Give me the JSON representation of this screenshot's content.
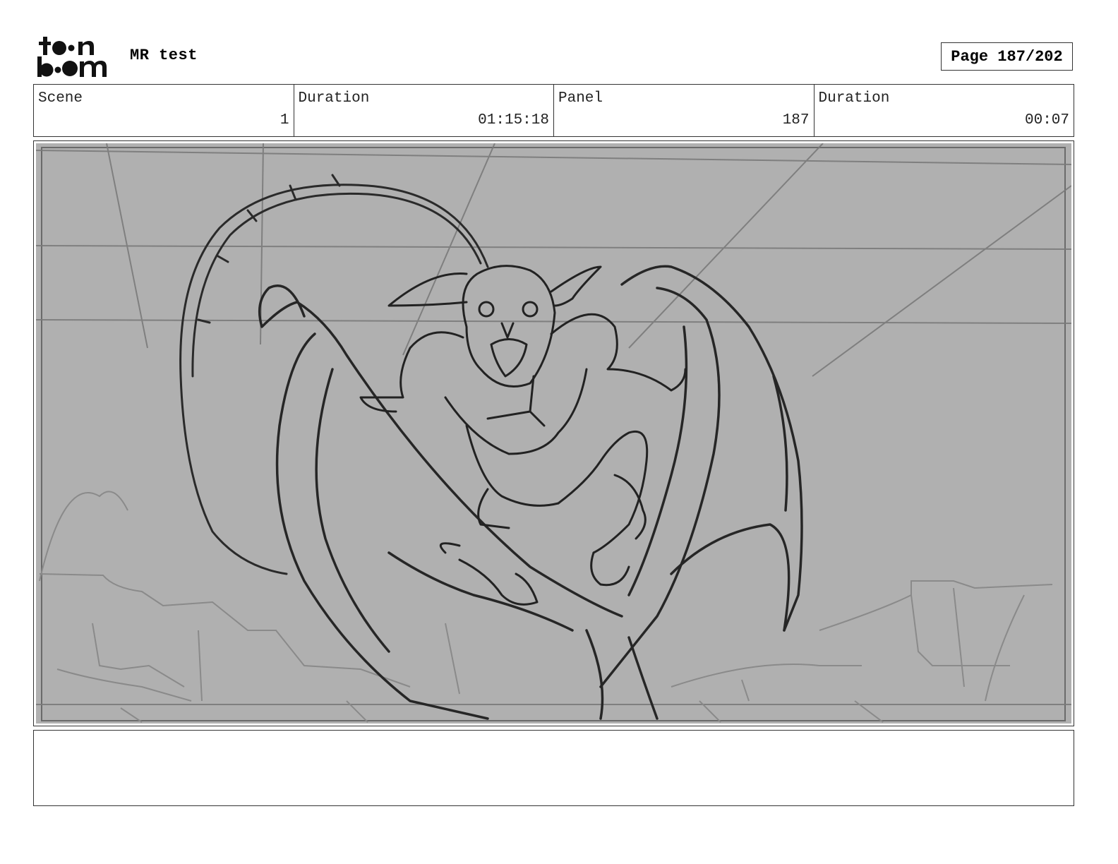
{
  "header": {
    "logo_text": "toon boom",
    "project_title": "MR test",
    "page_counter": "Page 187/202"
  },
  "info": {
    "scene_label": "Scene",
    "scene_value": "1",
    "scene_duration_label": "Duration",
    "scene_duration_value": "01:15:18",
    "panel_label": "Panel",
    "panel_value": "187",
    "panel_duration_label": "Duration",
    "panel_duration_value": "00:07"
  },
  "panel": {
    "background_color": "#b0b0b0",
    "line_color": "#2a2a2a",
    "guide_color": "#7a7a7a"
  },
  "notes": {
    "text": ""
  }
}
